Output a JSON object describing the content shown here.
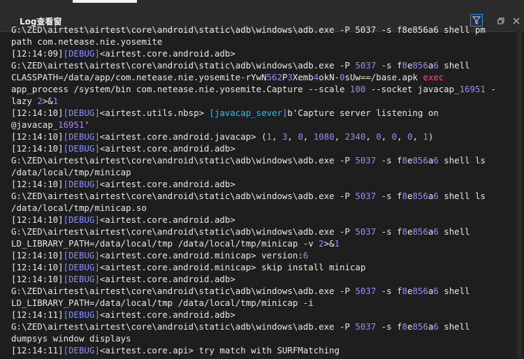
{
  "window": {
    "title": "Log查看窗"
  },
  "toolbar": {
    "filter_icon": "filter-icon",
    "restore_icon": "restore-icon",
    "close_icon": "close-icon"
  },
  "log": {
    "lines": [
      {
        "segments": [
          {
            "t": "G:\\ZED\\airtest\\airtest\\core\\android\\static\\adb\\windows\\adb.exe -P 5037 -s f8e856a6 shell pm",
            "c": ""
          }
        ]
      },
      {
        "segments": [
          {
            "t": "path com.netease.nie.yosemite",
            "c": ""
          }
        ]
      },
      {
        "segments": [
          {
            "t": "[12:14:09]",
            "c": "ts"
          },
          {
            "t": "[DEBUG]",
            "c": "dbg"
          },
          {
            "t": "<airtest.core.android.adb>",
            "c": ""
          }
        ]
      },
      {
        "segments": [
          {
            "t": "G:\\ZED\\airtest\\airtest\\core\\android\\static\\adb\\windows\\adb.exe -P ",
            "c": ""
          },
          {
            "t": "5037",
            "c": "num"
          },
          {
            "t": " -s f",
            "c": ""
          },
          {
            "t": "8",
            "c": "num"
          },
          {
            "t": "e",
            "c": ""
          },
          {
            "t": "856",
            "c": "num"
          },
          {
            "t": "a",
            "c": ""
          },
          {
            "t": "6",
            "c": "num"
          },
          {
            "t": " shell",
            "c": ""
          }
        ]
      },
      {
        "segments": [
          {
            "t": "CLASSPATH=/data/app/com.netease.nie.yosemite-rYwN",
            "c": ""
          },
          {
            "t": "562",
            "c": "num"
          },
          {
            "t": "P",
            "c": ""
          },
          {
            "t": "3",
            "c": "num"
          },
          {
            "t": "Xemb",
            "c": ""
          },
          {
            "t": "4",
            "c": "num"
          },
          {
            "t": "okN-",
            "c": ""
          },
          {
            "t": "0",
            "c": "num"
          },
          {
            "t": "sUw==/base.apk ",
            "c": ""
          },
          {
            "t": "exec",
            "c": "red"
          }
        ]
      },
      {
        "segments": [
          {
            "t": "app_process /system/bin com.netease.nie.yosemite.Capture --scale ",
            "c": ""
          },
          {
            "t": "100",
            "c": "num"
          },
          {
            "t": " --socket javacap_",
            "c": ""
          },
          {
            "t": "16951",
            "c": "num"
          },
          {
            "t": " -",
            "c": ""
          }
        ]
      },
      {
        "segments": [
          {
            "t": "lazy ",
            "c": ""
          },
          {
            "t": "2",
            "c": "num"
          },
          {
            "t": ">&",
            "c": ""
          },
          {
            "t": "1",
            "c": "num"
          }
        ]
      },
      {
        "segments": [
          {
            "t": "[12:14:10]",
            "c": "ts"
          },
          {
            "t": "[DEBUG]",
            "c": "dbg"
          },
          {
            "t": "<airtest.utils.nbsp> ",
            "c": ""
          },
          {
            "t": "[javacap_sever]",
            "c": "cyan"
          },
          {
            "t": "b'Capture server listening on",
            "c": ""
          }
        ]
      },
      {
        "segments": [
          {
            "t": "@javacap_",
            "c": ""
          },
          {
            "t": "16951",
            "c": "num"
          },
          {
            "t": "'",
            "c": ""
          }
        ]
      },
      {
        "segments": [
          {
            "t": "[12:14:10]",
            "c": "ts"
          },
          {
            "t": "[DEBUG]",
            "c": "dbg"
          },
          {
            "t": "<airtest.core.android.javacap> (",
            "c": ""
          },
          {
            "t": "1",
            "c": "num"
          },
          {
            "t": ", ",
            "c": ""
          },
          {
            "t": "3",
            "c": "num"
          },
          {
            "t": ", ",
            "c": ""
          },
          {
            "t": "0",
            "c": "num"
          },
          {
            "t": ", ",
            "c": ""
          },
          {
            "t": "1080",
            "c": "num"
          },
          {
            "t": ", ",
            "c": ""
          },
          {
            "t": "2340",
            "c": "num"
          },
          {
            "t": ", ",
            "c": ""
          },
          {
            "t": "0",
            "c": "num"
          },
          {
            "t": ", ",
            "c": ""
          },
          {
            "t": "0",
            "c": "num"
          },
          {
            "t": ", ",
            "c": ""
          },
          {
            "t": "0",
            "c": "num"
          },
          {
            "t": ", ",
            "c": ""
          },
          {
            "t": "1",
            "c": "num"
          },
          {
            "t": ")",
            "c": ""
          }
        ]
      },
      {
        "segments": [
          {
            "t": "[12:14:10]",
            "c": "ts"
          },
          {
            "t": "[DEBUG]",
            "c": "dbg"
          },
          {
            "t": "<airtest.core.android.adb>",
            "c": ""
          }
        ]
      },
      {
        "segments": [
          {
            "t": "G:\\ZED\\airtest\\airtest\\core\\android\\static\\adb\\windows\\adb.exe -P ",
            "c": ""
          },
          {
            "t": "5037",
            "c": "num"
          },
          {
            "t": " -s f",
            "c": ""
          },
          {
            "t": "8",
            "c": "num"
          },
          {
            "t": "e",
            "c": ""
          },
          {
            "t": "856",
            "c": "num"
          },
          {
            "t": "a",
            "c": ""
          },
          {
            "t": "6",
            "c": "num"
          },
          {
            "t": " shell ls",
            "c": ""
          }
        ]
      },
      {
        "segments": [
          {
            "t": "/data/local/tmp/minicap",
            "c": ""
          }
        ]
      },
      {
        "segments": [
          {
            "t": "[12:14:10]",
            "c": "ts"
          },
          {
            "t": "[DEBUG]",
            "c": "dbg"
          },
          {
            "t": "<airtest.core.android.adb>",
            "c": ""
          }
        ]
      },
      {
        "segments": [
          {
            "t": "G:\\ZED\\airtest\\airtest\\core\\android\\static\\adb\\windows\\adb.exe -P ",
            "c": ""
          },
          {
            "t": "5037",
            "c": "num"
          },
          {
            "t": " -s f",
            "c": ""
          },
          {
            "t": "8",
            "c": "num"
          },
          {
            "t": "e",
            "c": ""
          },
          {
            "t": "856",
            "c": "num"
          },
          {
            "t": "a",
            "c": ""
          },
          {
            "t": "6",
            "c": "num"
          },
          {
            "t": " shell ls",
            "c": ""
          }
        ]
      },
      {
        "segments": [
          {
            "t": "/data/local/tmp/minicap.so",
            "c": ""
          }
        ]
      },
      {
        "segments": [
          {
            "t": "[12:14:10]",
            "c": "ts"
          },
          {
            "t": "[DEBUG]",
            "c": "dbg"
          },
          {
            "t": "<airtest.core.android.adb>",
            "c": ""
          }
        ]
      },
      {
        "segments": [
          {
            "t": "G:\\ZED\\airtest\\airtest\\core\\android\\static\\adb\\windows\\adb.exe -P ",
            "c": ""
          },
          {
            "t": "5037",
            "c": "num"
          },
          {
            "t": " -s f",
            "c": ""
          },
          {
            "t": "8",
            "c": "num"
          },
          {
            "t": "e",
            "c": ""
          },
          {
            "t": "856",
            "c": "num"
          },
          {
            "t": "a",
            "c": ""
          },
          {
            "t": "6",
            "c": "num"
          },
          {
            "t": " shell",
            "c": ""
          }
        ]
      },
      {
        "segments": [
          {
            "t": "LD_LIBRARY_PATH=/data/local/tmp /data/local/tmp/minicap -v ",
            "c": ""
          },
          {
            "t": "2",
            "c": "num"
          },
          {
            "t": ">&",
            "c": ""
          },
          {
            "t": "1",
            "c": "num"
          }
        ]
      },
      {
        "segments": [
          {
            "t": "[12:14:10]",
            "c": "ts"
          },
          {
            "t": "[DEBUG]",
            "c": "dbg"
          },
          {
            "t": "<airtest.core.android.minicap> version:",
            "c": ""
          },
          {
            "t": "6",
            "c": "num"
          }
        ]
      },
      {
        "segments": [
          {
            "t": "[12:14:10]",
            "c": "ts"
          },
          {
            "t": "[DEBUG]",
            "c": "dbg"
          },
          {
            "t": "<airtest.core.android.minicap> skip install minicap",
            "c": ""
          }
        ]
      },
      {
        "segments": [
          {
            "t": "[12:14:10]",
            "c": "ts"
          },
          {
            "t": "[DEBUG]",
            "c": "dbg"
          },
          {
            "t": "<airtest.core.android.adb>",
            "c": ""
          }
        ]
      },
      {
        "segments": [
          {
            "t": "G:\\ZED\\airtest\\airtest\\core\\android\\static\\adb\\windows\\adb.exe -P ",
            "c": ""
          },
          {
            "t": "5037",
            "c": "num"
          },
          {
            "t": " -s f",
            "c": ""
          },
          {
            "t": "8",
            "c": "num"
          },
          {
            "t": "e",
            "c": ""
          },
          {
            "t": "856",
            "c": "num"
          },
          {
            "t": "a",
            "c": ""
          },
          {
            "t": "6",
            "c": "num"
          },
          {
            "t": " shell",
            "c": ""
          }
        ]
      },
      {
        "segments": [
          {
            "t": "LD_LIBRARY_PATH=/data/local/tmp /data/local/tmp/minicap -i",
            "c": ""
          }
        ]
      },
      {
        "segments": [
          {
            "t": "[12:14:11]",
            "c": "ts"
          },
          {
            "t": "[DEBUG]",
            "c": "dbg"
          },
          {
            "t": "<airtest.core.android.adb>",
            "c": ""
          }
        ]
      },
      {
        "segments": [
          {
            "t": "G:\\ZED\\airtest\\airtest\\core\\android\\static\\adb\\windows\\adb.exe -P ",
            "c": ""
          },
          {
            "t": "5037",
            "c": "num"
          },
          {
            "t": " -s f",
            "c": ""
          },
          {
            "t": "8",
            "c": "num"
          },
          {
            "t": "e",
            "c": ""
          },
          {
            "t": "856",
            "c": "num"
          },
          {
            "t": "a",
            "c": ""
          },
          {
            "t": "6",
            "c": "num"
          },
          {
            "t": " shell",
            "c": ""
          }
        ]
      },
      {
        "segments": [
          {
            "t": "dumpsys window displays",
            "c": ""
          }
        ]
      },
      {
        "segments": [
          {
            "t": "[12:14:11]",
            "c": "ts"
          },
          {
            "t": "[DEBUG]",
            "c": "dbg"
          },
          {
            "t": "<airtest.core.api> try match with SURFMatching",
            "c": ""
          }
        ]
      }
    ]
  }
}
